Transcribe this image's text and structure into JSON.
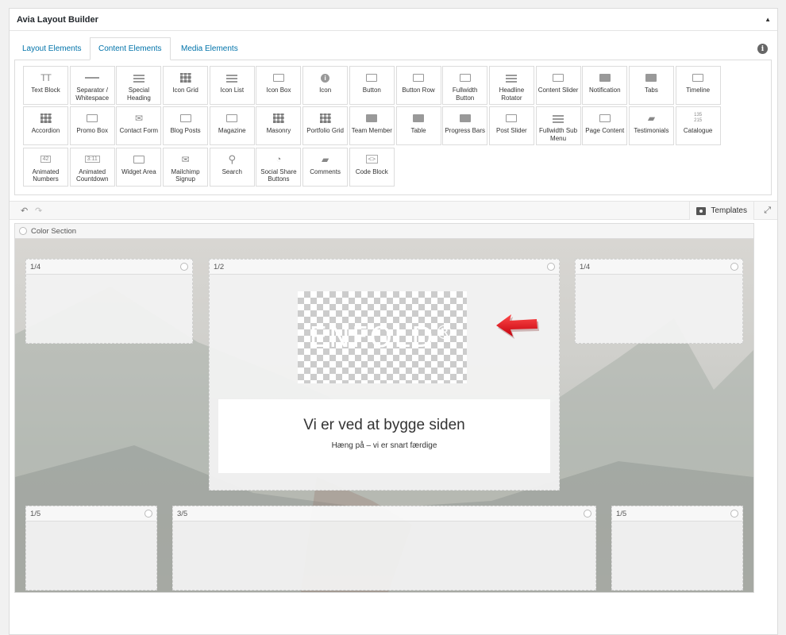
{
  "panel": {
    "title": "Avia Layout Builder"
  },
  "tabs": [
    {
      "label": "Layout Elements",
      "active": false
    },
    {
      "label": "Content Elements",
      "active": true
    },
    {
      "label": "Media Elements",
      "active": false
    }
  ],
  "elements": [
    {
      "label": "Text Block",
      "icon": "text-block-icon"
    },
    {
      "label": "Separator / Whitespace",
      "icon": "separator-icon"
    },
    {
      "label": "Special Heading",
      "icon": "heading-icon"
    },
    {
      "label": "Icon Grid",
      "icon": "icon-grid-icon"
    },
    {
      "label": "Icon List",
      "icon": "icon-list-icon"
    },
    {
      "label": "Icon Box",
      "icon": "icon-box-icon"
    },
    {
      "label": "Icon",
      "icon": "info-circle-icon"
    },
    {
      "label": "Button",
      "icon": "button-icon"
    },
    {
      "label": "Button Row",
      "icon": "button-row-icon"
    },
    {
      "label": "Fullwidth Button",
      "icon": "fullwidth-button-icon"
    },
    {
      "label": "Headline Rotator",
      "icon": "headline-rotator-icon"
    },
    {
      "label": "Content Slider",
      "icon": "content-slider-icon"
    },
    {
      "label": "Notification",
      "icon": "notification-icon"
    },
    {
      "label": "Tabs",
      "icon": "tabs-icon"
    },
    {
      "label": "Timeline",
      "icon": "timeline-icon"
    },
    {
      "label": "Accordion",
      "icon": "accordion-icon"
    },
    {
      "label": "Promo Box",
      "icon": "promo-box-icon"
    },
    {
      "label": "Contact Form",
      "icon": "envelope-icon"
    },
    {
      "label": "Blog Posts",
      "icon": "blog-posts-icon"
    },
    {
      "label": "Magazine",
      "icon": "magazine-icon"
    },
    {
      "label": "Masonry",
      "icon": "masonry-icon"
    },
    {
      "label": "Portfolio Grid",
      "icon": "portfolio-grid-icon"
    },
    {
      "label": "Team Member",
      "icon": "team-icon"
    },
    {
      "label": "Table",
      "icon": "table-icon"
    },
    {
      "label": "Progress Bars",
      "icon": "progress-bars-icon"
    },
    {
      "label": "Post Slider",
      "icon": "post-slider-icon"
    },
    {
      "label": "Fullwidth Sub Menu",
      "icon": "sub-menu-icon"
    },
    {
      "label": "Page Content",
      "icon": "page-icon"
    },
    {
      "label": "Testimonials",
      "icon": "speech-bubble-icon"
    },
    {
      "label": "Catalogue",
      "icon": "catalogue-icon"
    },
    {
      "label": "Animated Numbers",
      "icon": "animated-numbers-icon"
    },
    {
      "label": "Animated Countdown",
      "icon": "countdown-icon"
    },
    {
      "label": "Widget Area",
      "icon": "widget-area-icon"
    },
    {
      "label": "Mailchimp Signup",
      "icon": "mail-icon"
    },
    {
      "label": "Search",
      "icon": "search-icon"
    },
    {
      "label": "Social Share Buttons",
      "icon": "share-icon"
    },
    {
      "label": "Comments",
      "icon": "comments-icon"
    },
    {
      "label": "Code Block",
      "icon": "code-icon"
    }
  ],
  "el_icon_text": {
    "text_block": "TT",
    "icon": "i",
    "countdown": "3:11",
    "numbers": "42",
    "catalogue_a": "135",
    "catalogue_b": "215"
  },
  "toolbar": {
    "templates_label": "Templates"
  },
  "section": {
    "label": "Color Section",
    "columns": {
      "top_left": "1/4",
      "top_mid": "1/2",
      "top_right": "1/4",
      "bot_left": "1/5",
      "bot_mid": "3/5",
      "bot_right": "1/5"
    },
    "logo_text": "ENFOLD",
    "logo_mark": "®",
    "heading": "Vi er ved at bygge siden",
    "subheading": "Hæng på – vi er snart færdige"
  },
  "colors": {
    "link": "#0073aa",
    "arrow": "#e3101e"
  }
}
